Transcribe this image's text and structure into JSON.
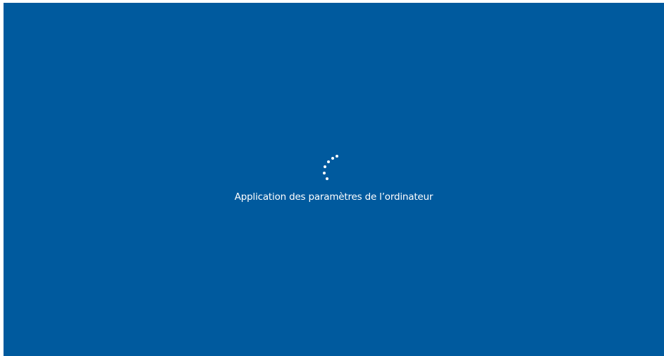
{
  "screen": {
    "status_message": "Application des paramètres de l’ordinateur",
    "background_color": "#005a9e",
    "text_color": "#ffffff",
    "spinner_icon": "loading-dots-spinner-icon"
  }
}
